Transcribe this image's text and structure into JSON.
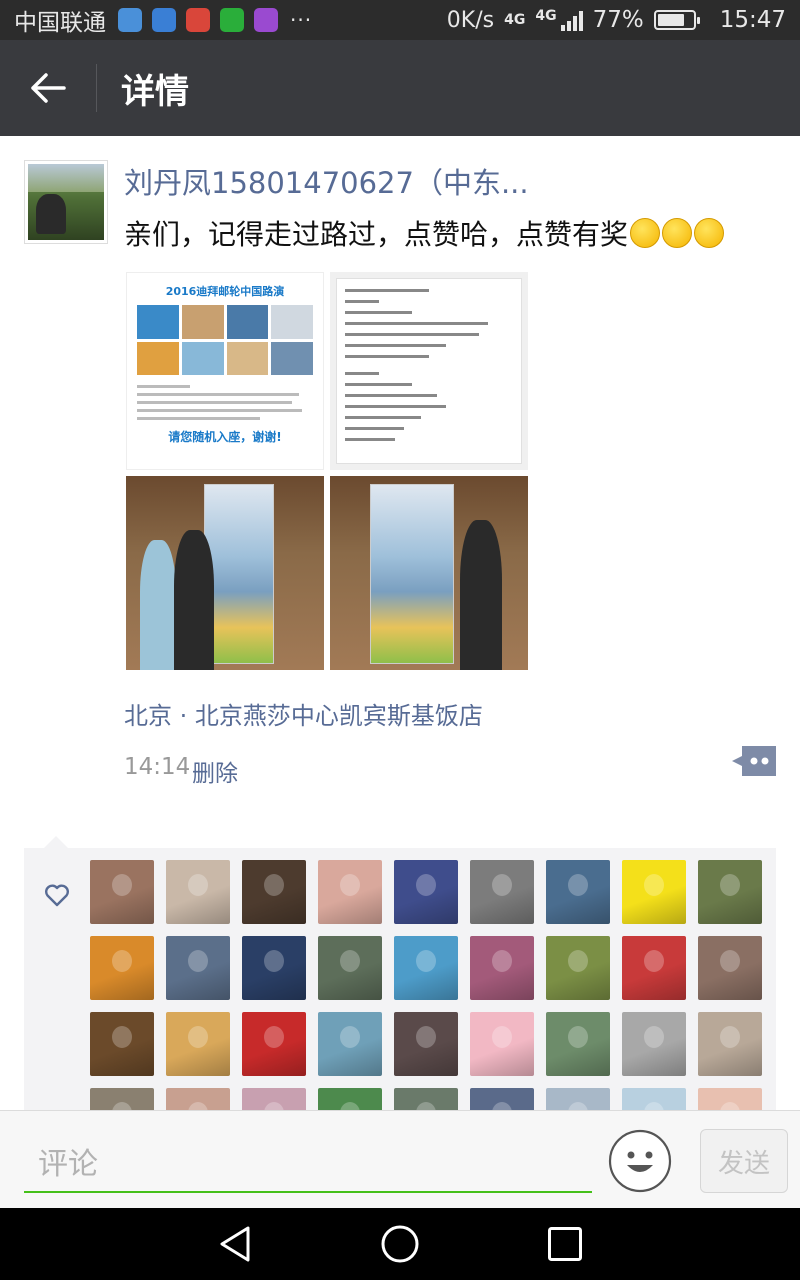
{
  "status_bar": {
    "carrier": "中国联通",
    "dots": "···",
    "net_speed": "0K/s",
    "net_type_1": "4G",
    "net_type_2": "4G",
    "battery": "77%",
    "battery_level": 0.77,
    "time": "15:47"
  },
  "header": {
    "title": "详情"
  },
  "post": {
    "author": "刘丹凤15801470627（中东...",
    "text": "亲们，记得走过路过，点赞哈，点赞有奖",
    "emoji_count": 3,
    "photos": [
      {
        "kind": "flyer",
        "title": "2016迪拜邮轮中国路演",
        "cta": "请您随机入座，谢谢!"
      },
      {
        "kind": "sms-screenshot"
      },
      {
        "kind": "event-photo"
      },
      {
        "kind": "event-photo"
      }
    ],
    "location": "北京 · 北京燕莎中心凯宾斯基饭店",
    "time": "14:14",
    "delete_label": "删除"
  },
  "likes": {
    "count_shown": 36,
    "avatar_colors": [
      "#9a7360",
      "#c9b8a8",
      "#4d3b2e",
      "#d9a89c",
      "#3f4d8c",
      "#7c7c7c",
      "#4a6d8f",
      "#f4e01a",
      "#6a7a4a",
      "#d98a2a",
      "#5b6f8a",
      "#2a3f66",
      "#5d6e5a",
      "#4d9cc9",
      "#a35a7a",
      "#7b8f45",
      "#c83a3a",
      "#8a6f63",
      "#6b4a2a",
      "#d9a85a",
      "#c72a2a",
      "#6fa0b8",
      "#5a4a4a",
      "#f2b8c4",
      "#6d8c6a",
      "#a8a8a8",
      "#b8a898",
      "#8a8070",
      "#c8a090",
      "#c8a0b0",
      "#4d8a4d",
      "#6a7a6a",
      "#5a6a8a",
      "#a8b8c8",
      "#b8d0e0",
      "#e8c0b0"
    ]
  },
  "comment_bar": {
    "placeholder": "评论",
    "send_label": "发送"
  }
}
